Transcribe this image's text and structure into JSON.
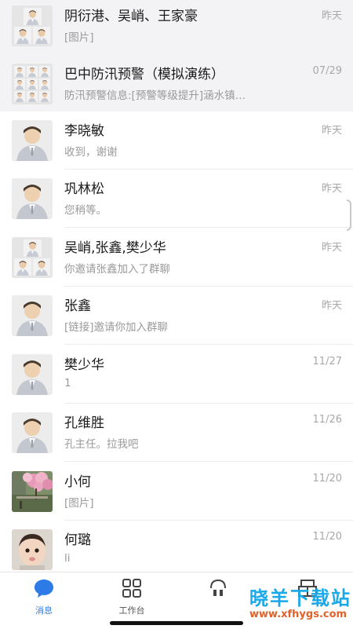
{
  "chats": [
    {
      "name": "阴衍港、吴峭、王家豪",
      "preview": "[图片]",
      "time": "昨天",
      "avatar": "group-3",
      "pinned": true
    },
    {
      "name": "巴中防汛预警（模拟演练）",
      "preview": "防汛预警信息:[预警等级提升]涵水镇…",
      "time": "07/29",
      "avatar": "group-9",
      "pinned": true
    },
    {
      "name": "李晓敏",
      "preview": "收到，谢谢",
      "time": "昨天",
      "avatar": "default-person"
    },
    {
      "name": "巩林松",
      "preview": "您稍等。",
      "time": "昨天",
      "avatar": "default-person"
    },
    {
      "name": "吴峭,张鑫,樊少华",
      "preview": "你邀请张鑫加入了群聊",
      "time": "昨天",
      "avatar": "group-3"
    },
    {
      "name": "张鑫",
      "preview": "[链接]邀请你加入群聊",
      "time": "昨天",
      "avatar": "default-person"
    },
    {
      "name": "樊少华",
      "preview": "1",
      "time": "11/27",
      "avatar": "default-person"
    },
    {
      "name": "孔维胜",
      "preview": "孔主任。拉我吧",
      "time": "11/26",
      "avatar": "default-person"
    },
    {
      "name": "小何",
      "preview": "[图片]",
      "time": "11/20",
      "avatar": "photo-flowers"
    },
    {
      "name": "何璐",
      "preview": "li",
      "time": "11/20",
      "avatar": "photo-child"
    }
  ],
  "tabs": [
    {
      "label": "消息",
      "icon": "chat-bubble-icon",
      "active": true
    },
    {
      "label": "工作台",
      "icon": "grid-icon",
      "active": false
    },
    {
      "label": "",
      "icon": "contacts-icon",
      "active": false
    },
    {
      "label": "",
      "icon": "me-icon",
      "active": false
    }
  ],
  "watermark": {
    "title": "晓羊下载站",
    "url": "www.xfhygs.com"
  },
  "colors": {
    "accent": "#2d7be6",
    "pinned_bg": "#f3f3f5",
    "muted_text": "#9a9a9a"
  }
}
